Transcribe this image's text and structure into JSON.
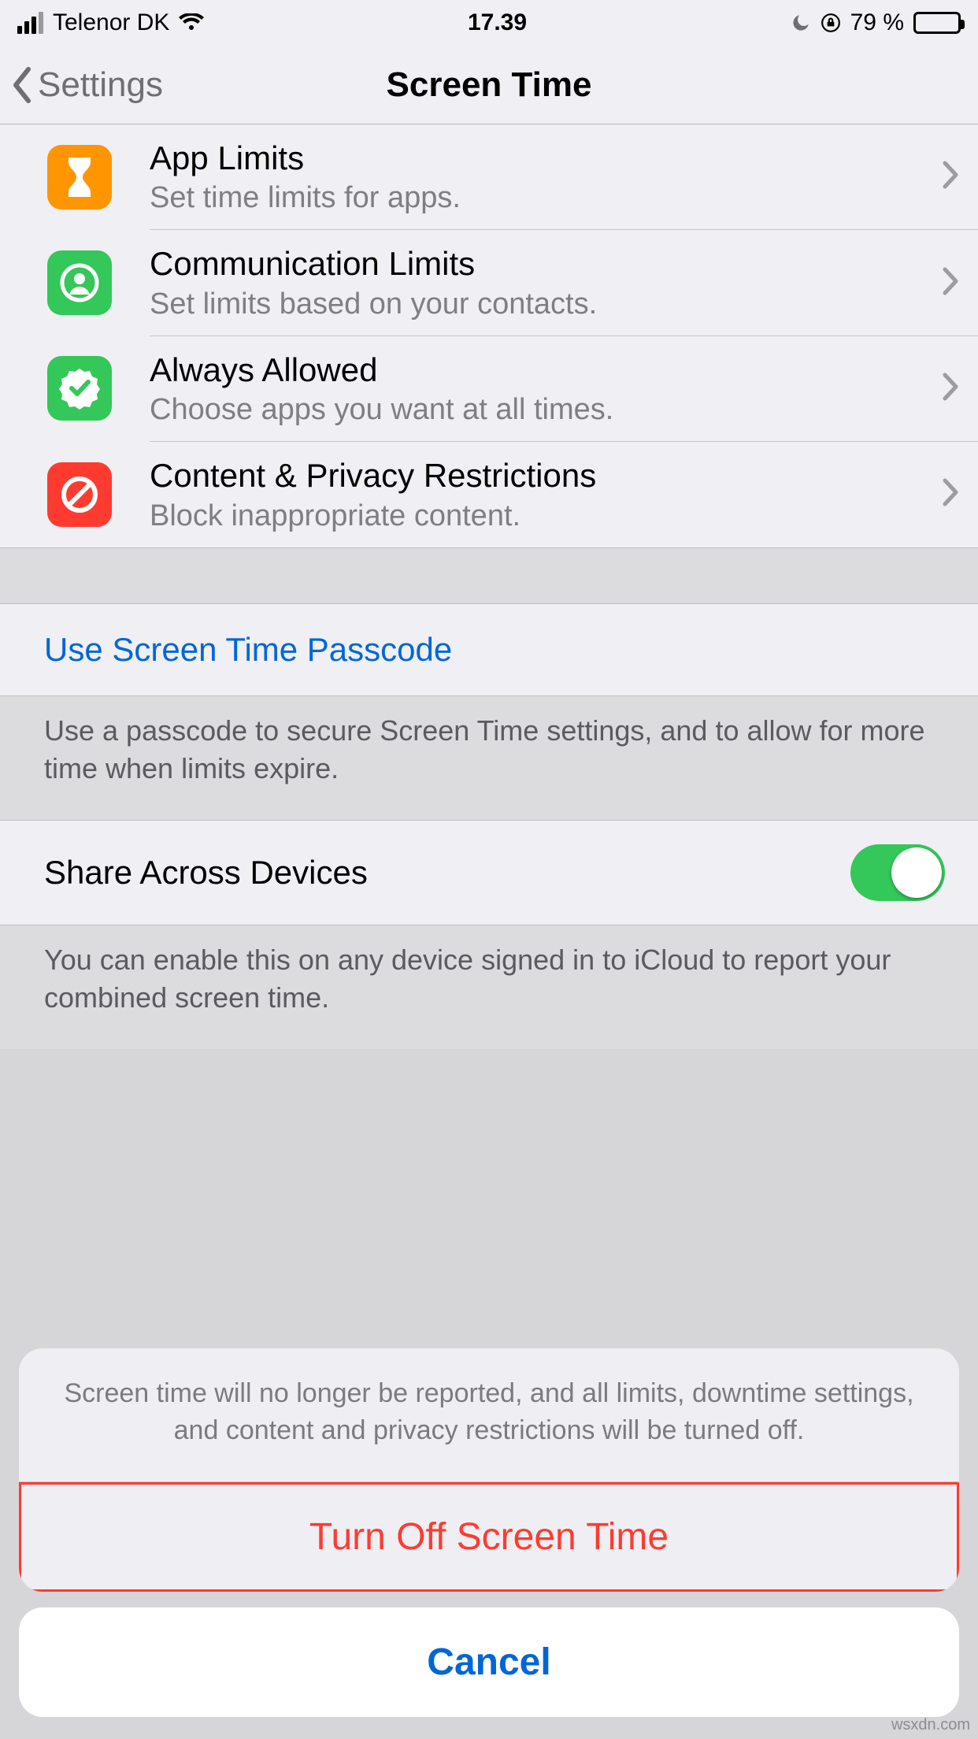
{
  "status": {
    "carrier": "Telenor DK",
    "time": "17.39",
    "battery_pct": "79 %"
  },
  "nav": {
    "back_label": "Settings",
    "title": "Screen Time"
  },
  "rows": {
    "app_limits": {
      "title": "App Limits",
      "subtitle": "Set time limits for apps."
    },
    "comm_limits": {
      "title": "Communication Limits",
      "subtitle": "Set limits based on your contacts."
    },
    "always_allowed": {
      "title": "Always Allowed",
      "subtitle": "Choose apps you want at all times."
    },
    "content_privacy": {
      "title": "Content & Privacy Restrictions",
      "subtitle": "Block inappropriate content."
    }
  },
  "passcode": {
    "link": "Use Screen Time Passcode",
    "footer": "Use a passcode to secure Screen Time settings, and to allow for more time when limits expire."
  },
  "share": {
    "label": "Share Across Devices",
    "on": true,
    "footer": "You can enable this on any device signed in to iCloud to report your combined screen time."
  },
  "sheet": {
    "message": "Screen time will no longer be reported, and all limits, downtime settings, and content and privacy restrictions will be turned off.",
    "destructive": "Turn Off Screen Time",
    "cancel": "Cancel"
  },
  "watermark": "wsxdn.com"
}
